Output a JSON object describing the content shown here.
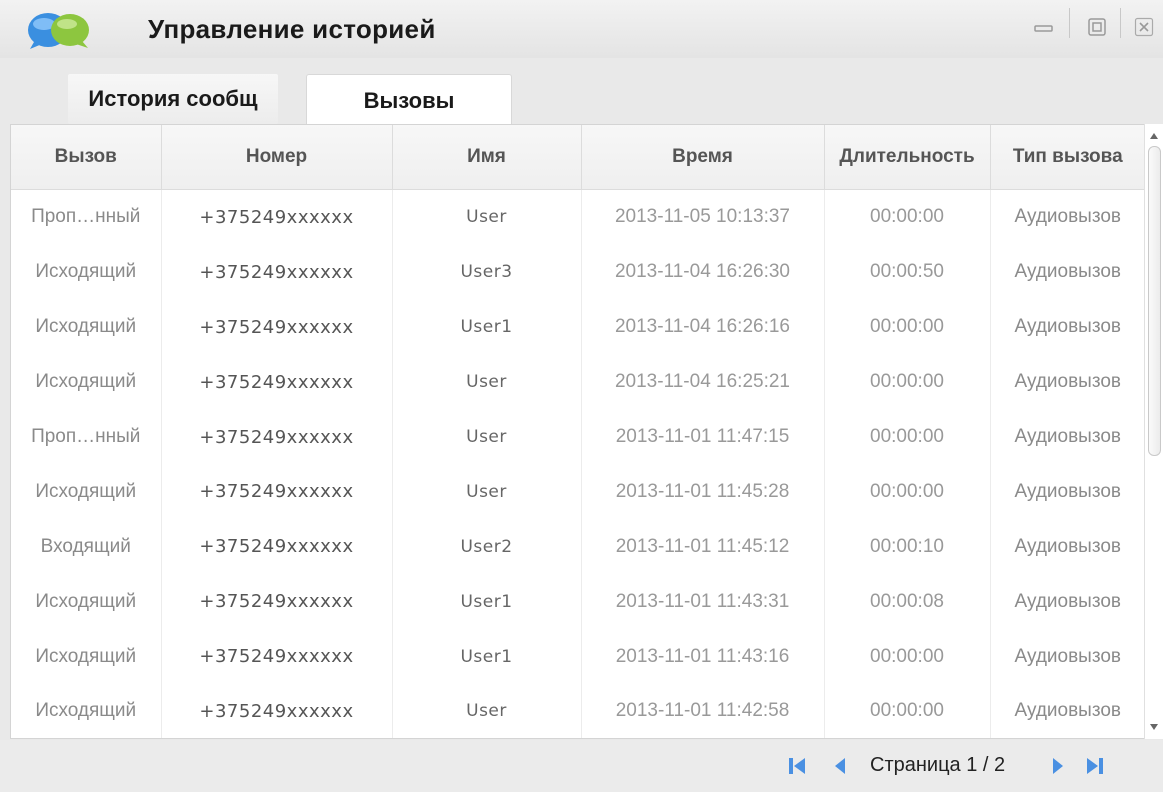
{
  "window": {
    "title": "Управление историей",
    "controls": [
      "minimize-icon",
      "maximize-icon",
      "close-icon"
    ]
  },
  "tabs": [
    {
      "label": "История сообщ",
      "active": false
    },
    {
      "label": "Вызовы",
      "active": true
    }
  ],
  "table": {
    "columns": [
      "Вызов",
      "Номер",
      "Имя",
      "Время",
      "Длительность",
      "Тип вызова"
    ],
    "rows": [
      {
        "call": "Проп…нный",
        "number": "+375249xxxxxx",
        "name": "User",
        "time": "2013-11-05  10:13:37",
        "duration": "00:00:00",
        "type": "Аудиовызов"
      },
      {
        "call": "Исходящий",
        "number": "+375249xxxxxx",
        "name": "User3",
        "time": "2013-11-04  16:26:30",
        "duration": "00:00:50",
        "type": "Аудиовызов"
      },
      {
        "call": "Исходящий",
        "number": "+375249xxxxxx",
        "name": "User1",
        "time": "2013-11-04  16:26:16",
        "duration": "00:00:00",
        "type": "Аудиовызов"
      },
      {
        "call": "Исходящий",
        "number": "+375249xxxxxx",
        "name": "User",
        "time": "2013-11-04  16:25:21",
        "duration": "00:00:00",
        "type": "Аудиовызов"
      },
      {
        "call": "Проп…нный",
        "number": "+375249xxxxxx",
        "name": "User",
        "time": "2013-11-01  11:47:15",
        "duration": "00:00:00",
        "type": "Аудиовызов"
      },
      {
        "call": "Исходящий",
        "number": "+375249xxxxxx",
        "name": "User",
        "time": "2013-11-01  11:45:28",
        "duration": "00:00:00",
        "type": "Аудиовызов"
      },
      {
        "call": "Входящий",
        "number": "+375249xxxxxx",
        "name": "User2",
        "time": "2013-11-01  11:45:12",
        "duration": "00:00:10",
        "type": "Аудиовызов"
      },
      {
        "call": "Исходящий",
        "number": "+375249xxxxxx",
        "name": "User1",
        "time": "2013-11-01  11:43:31",
        "duration": "00:00:08",
        "type": "Аудиовызов"
      },
      {
        "call": "Исходящий",
        "number": "+375249xxxxxx",
        "name": "User1",
        "time": "2013-11-01  11:43:16",
        "duration": "00:00:00",
        "type": "Аудиовызов"
      },
      {
        "call": "Исходящий",
        "number": "+375249xxxxxx",
        "name": "User",
        "time": "2013-11-01  11:42:58",
        "duration": "00:00:00",
        "type": "Аудиовызов"
      }
    ]
  },
  "pager": {
    "text": "Страница 1 / 2",
    "icons": [
      "first-page-icon",
      "prev-page-icon",
      "next-page-icon",
      "last-page-icon"
    ]
  },
  "colors": {
    "accent": "#4a90e2",
    "app_icon_blue": "#3a8fe0",
    "app_icon_green": "#8dc63f"
  }
}
